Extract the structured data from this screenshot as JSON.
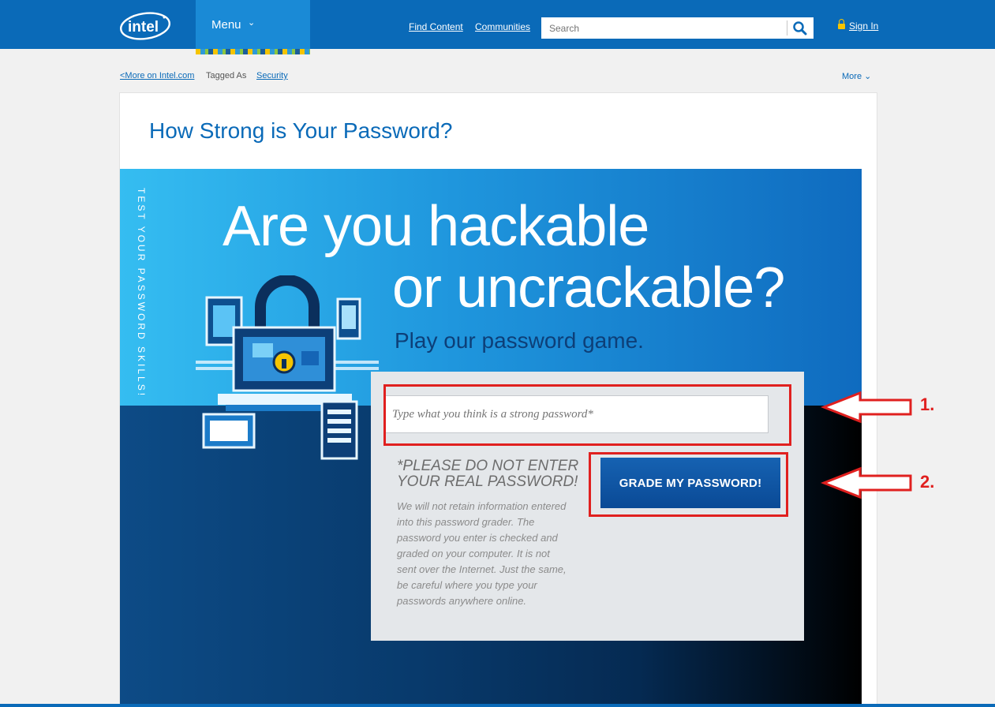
{
  "header": {
    "menu_label": "Menu",
    "links": [
      "Find Content",
      "Communities"
    ],
    "search_placeholder": "Search",
    "signin_label": "Sign In"
  },
  "breadcrumb": {
    "back_link": "<More on Intel.com",
    "tagged_as": "Tagged As",
    "tag": "Security",
    "more": "More"
  },
  "page": {
    "title": "How Strong is Your Password?"
  },
  "hero": {
    "side_text": "TEST YOUR PASSWORD SKILLS!",
    "headline_1": "Are you hackable",
    "headline_2": "or uncrackable?",
    "subhead": "Play our password game."
  },
  "form": {
    "password_placeholder": "Type what you think is a strong password*",
    "warning": "*PLEASE DO NOT ENTER YOUR REAL PASSWORD!",
    "disclaimer": "We will not retain information entered into this password grader. The password you enter is checked and graded on your computer. It is not sent over the Internet. Just the same, be careful where you type your passwords anywhere online.",
    "grade_button": "GRADE MY PASSWORD!"
  },
  "annotations": {
    "label_1": "1.",
    "label_2": "2.",
    "color": "#e0201f"
  },
  "colors": {
    "brand_blue": "#0a6ab8",
    "menu_blue": "#1a8ad6",
    "accent_yellow": "#f5c400"
  }
}
